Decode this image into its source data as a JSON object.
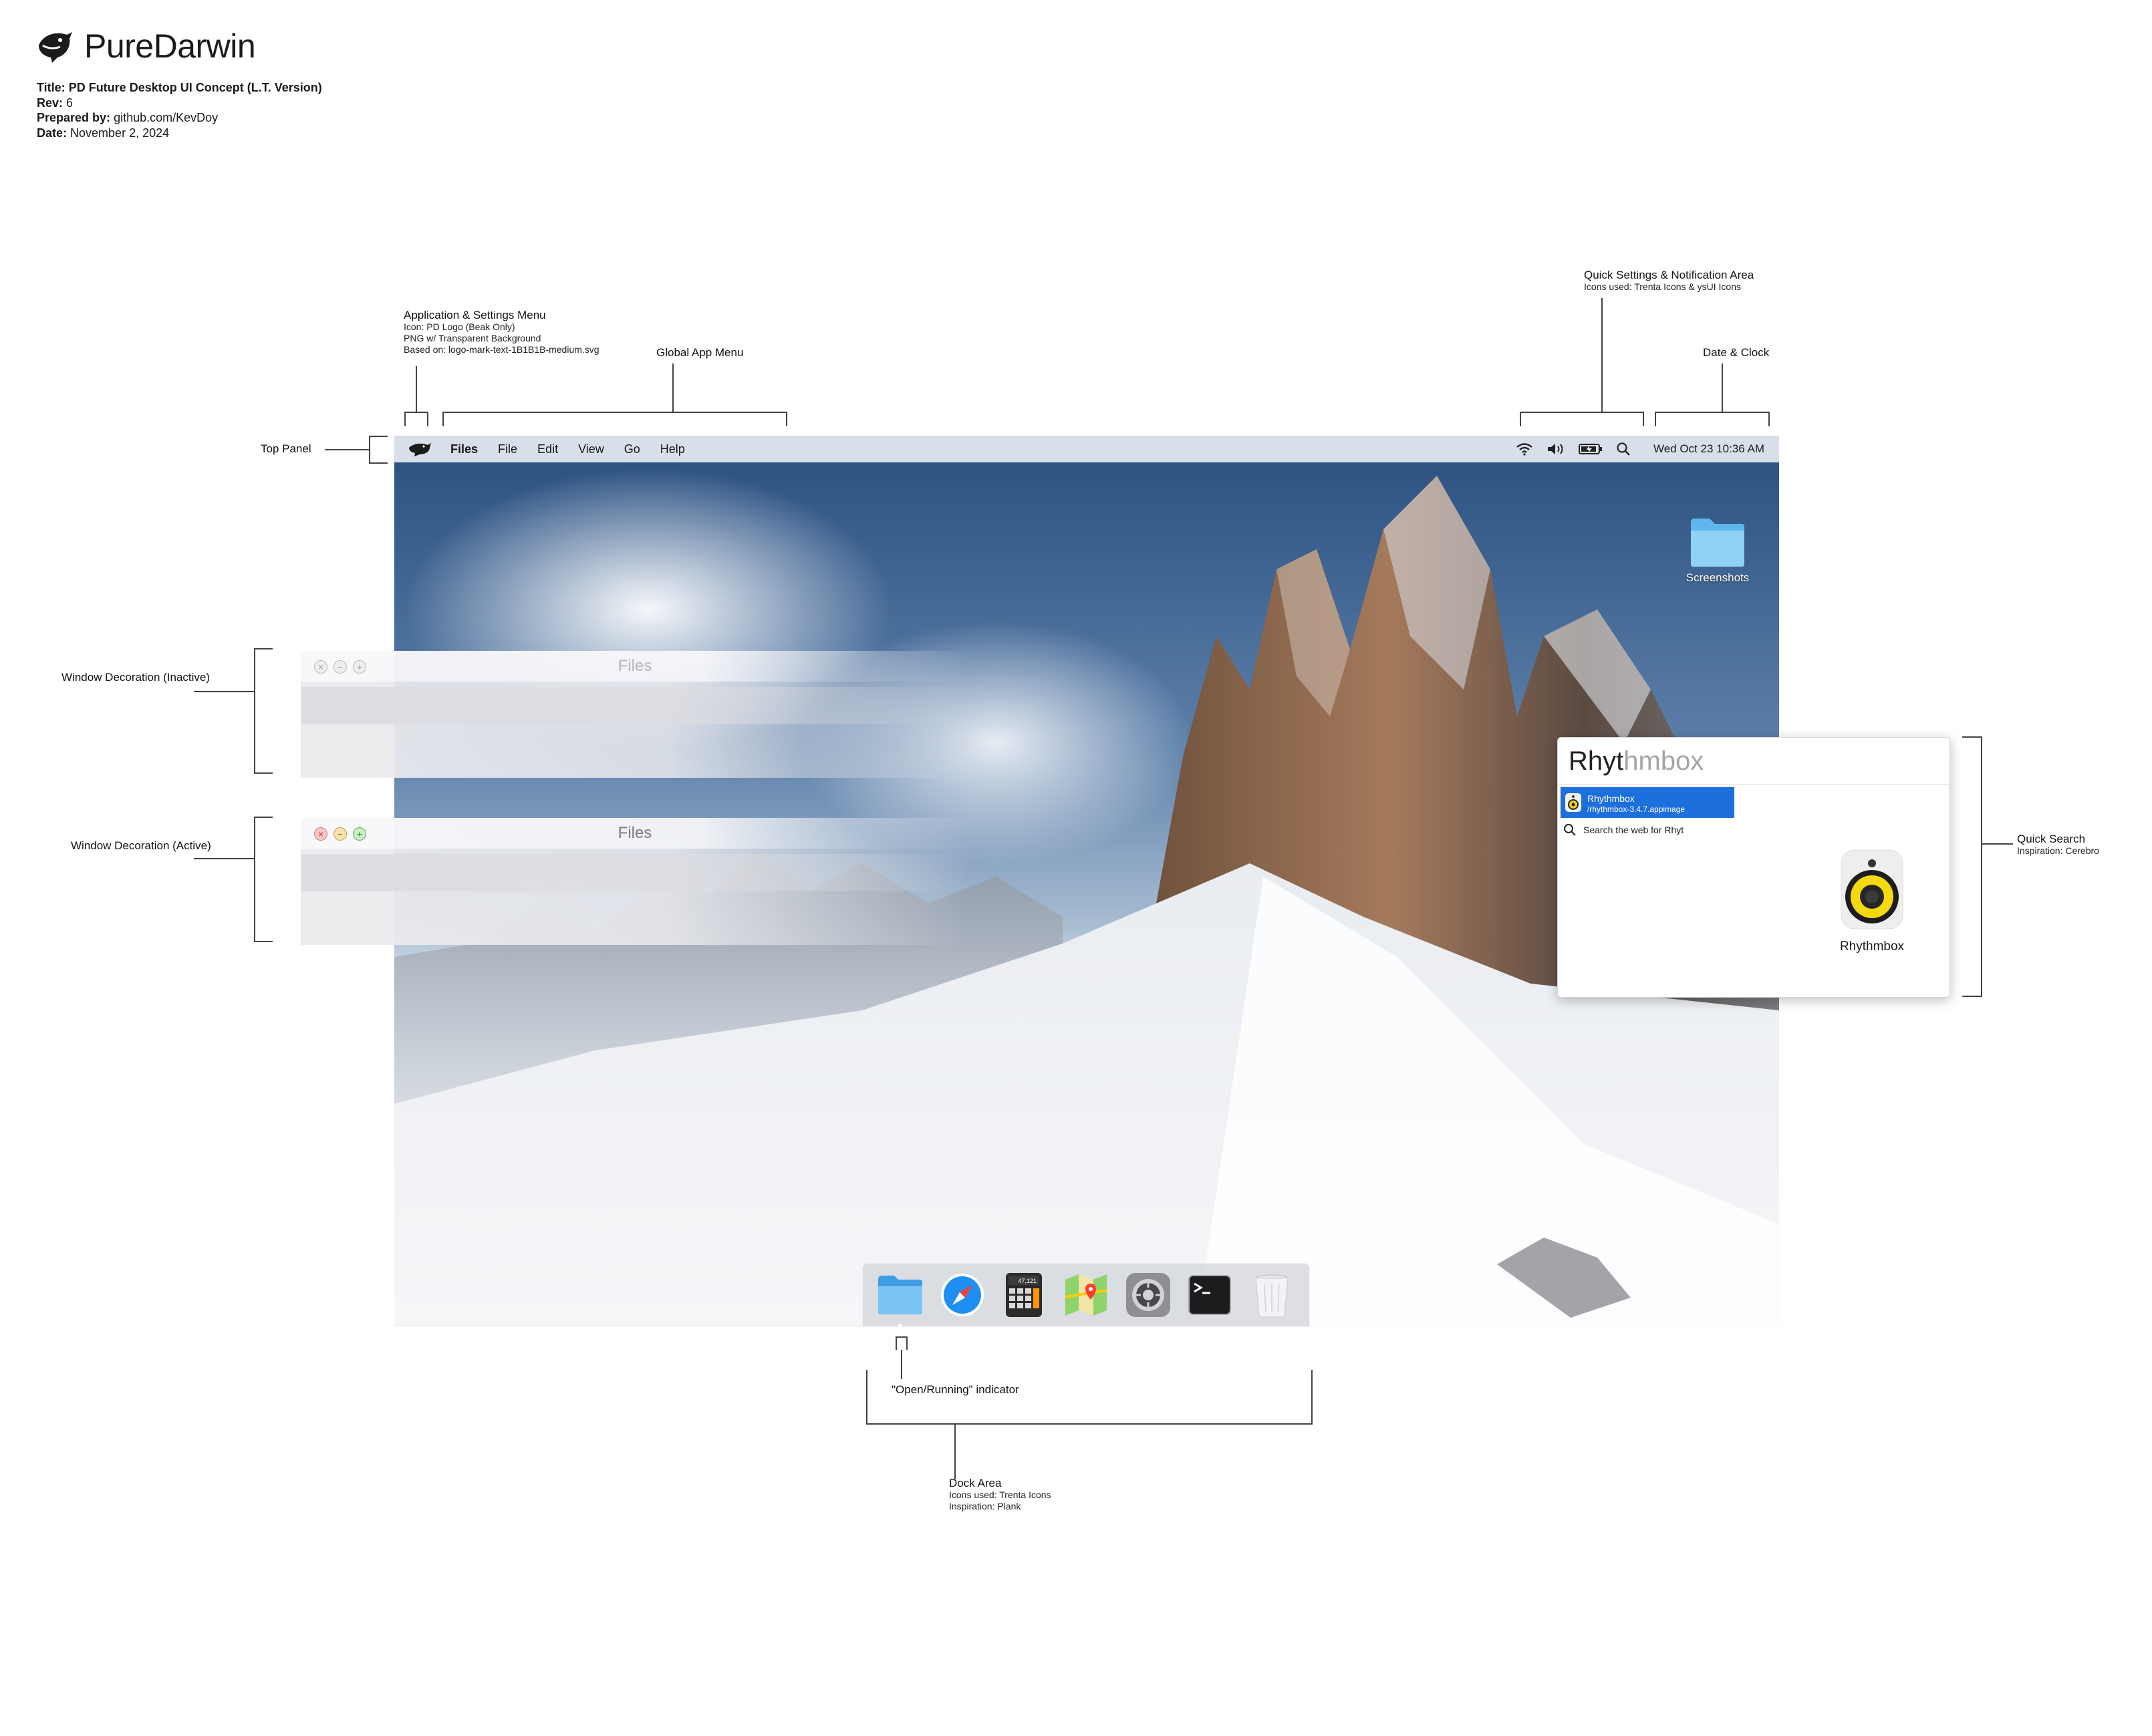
{
  "header": {
    "brand": "PureDarwin",
    "meta": [
      {
        "label": "Title:",
        "value": "PD Future Desktop UI Concept (L.T. Version)"
      },
      {
        "label": "Rev:",
        "value": "6"
      },
      {
        "label": "Prepared by:",
        "value": "github.com/KevDoy"
      },
      {
        "label": "Date:",
        "value": "November 2, 2024"
      }
    ]
  },
  "annotations": {
    "app_menu": {
      "title": "Application & Settings Menu",
      "lines": [
        "Icon: PD Logo (Beak Only)",
        "PNG w/ Transparent Background",
        "Based on: logo-mark-text-1B1B1B-medium.svg"
      ]
    },
    "global_menu": "Global App Menu",
    "quick_settings": {
      "title": "Quick Settings & Notification Area",
      "sub": "Icons used: Trenta Icons & ysUI Icons"
    },
    "date_clock": "Date & Clock",
    "top_panel": "Top Panel",
    "win_inactive": "Window Decoration (Inactive)",
    "win_active": "Window Decoration (Active)",
    "quick_search": {
      "title": "Quick Search",
      "sub": "Inspiration: Cerebro"
    },
    "running_indicator": "\"Open/Running\" indicator",
    "dock_area": {
      "title": "Dock Area",
      "lines": [
        "Icons used: Trenta Icons",
        "Inspiration: Plank"
      ]
    }
  },
  "topbar": {
    "menu": [
      "Files",
      "File",
      "Edit",
      "View",
      "Go",
      "Help"
    ],
    "clock": "Wed Oct 23 10:36 AM",
    "tray_icons": [
      "wifi-icon",
      "volume-icon",
      "battery-icon",
      "search-icon"
    ]
  },
  "desktop": {
    "icon_label": "Screenshots"
  },
  "windows": {
    "inactive_title": "Files",
    "active_title": "Files"
  },
  "quick_search": {
    "typed": "Rhyt",
    "completion": "hmbox",
    "result_title": "Rhythmbox",
    "result_path": "/rhythmbox-3.4.7.appimage",
    "web_search": "Search the web for Rhyt",
    "preview_label": "Rhythmbox"
  },
  "dock": {
    "items": [
      "folder-icon",
      "safari-icon",
      "calculator-icon",
      "maps-icon",
      "settings-icon",
      "terminal-icon",
      "trash-icon"
    ],
    "calculator_display": "47,121",
    "colors": {
      "accent": "#1d6fdc"
    }
  }
}
